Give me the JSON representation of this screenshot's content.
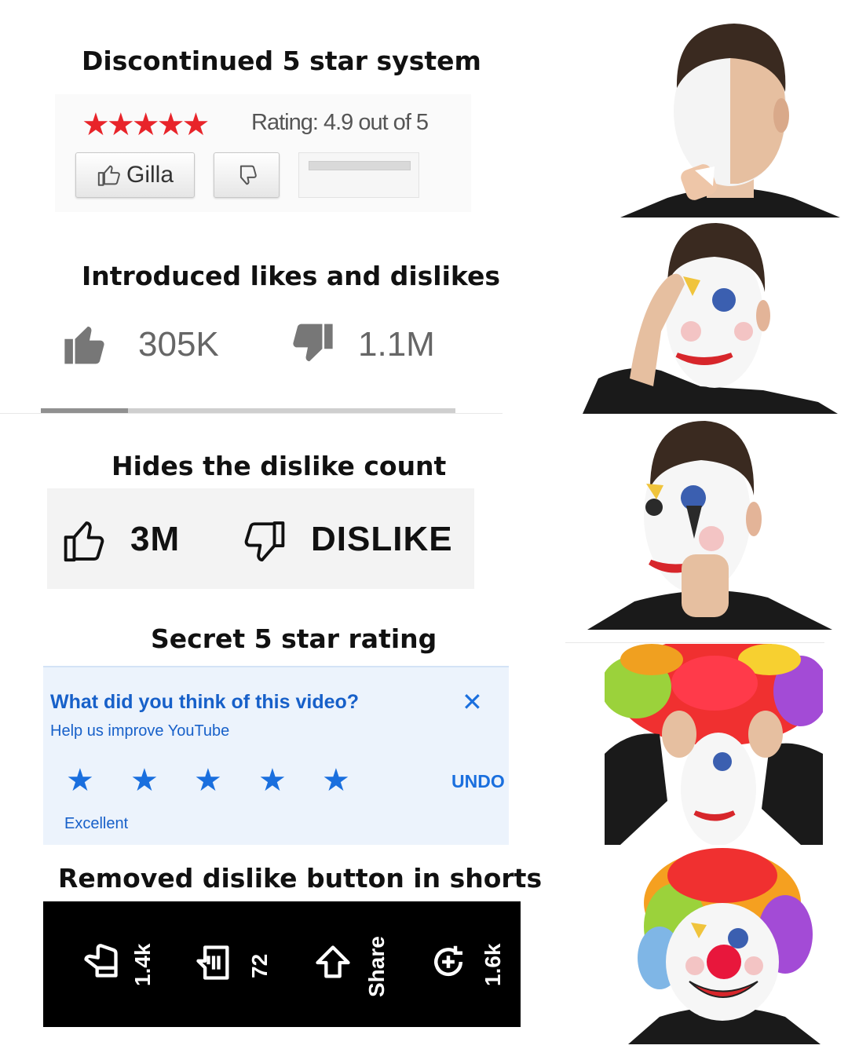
{
  "panels": [
    {
      "title": "Discontinued 5 star system",
      "stars": "★★★★★",
      "rating_text": "Rating: 4.9 out of 5",
      "like_button_label": "Gilla"
    },
    {
      "title": "Introduced likes and dislikes",
      "likes": "305K",
      "dislikes": "1.1M",
      "like_ratio": 0.21
    },
    {
      "title": "Hides the dislike count",
      "likes": "3M",
      "dislike_label": "DISLIKE"
    },
    {
      "title": "Secret 5 star rating",
      "question": "What did you think of this video?",
      "subtitle": "Help us improve YouTube",
      "close_glyph": "✕",
      "undo_label": "UNDO",
      "rating_label": "Excellent",
      "stars_filled": 5
    },
    {
      "title": "Removed dislike button in shorts",
      "actions": [
        {
          "icon": "dislike-icon",
          "value": "1.4k"
        },
        {
          "icon": "comment-icon",
          "value": "72"
        },
        {
          "icon": "share-icon",
          "value": "Share"
        },
        {
          "icon": "remix-icon",
          "value": "1.6k"
        }
      ]
    }
  ],
  "colors": {
    "star_red": "#e8242a",
    "link_blue": "#1760c9",
    "star_blue": "#1a6fde",
    "shorts_bg": "#000000"
  }
}
